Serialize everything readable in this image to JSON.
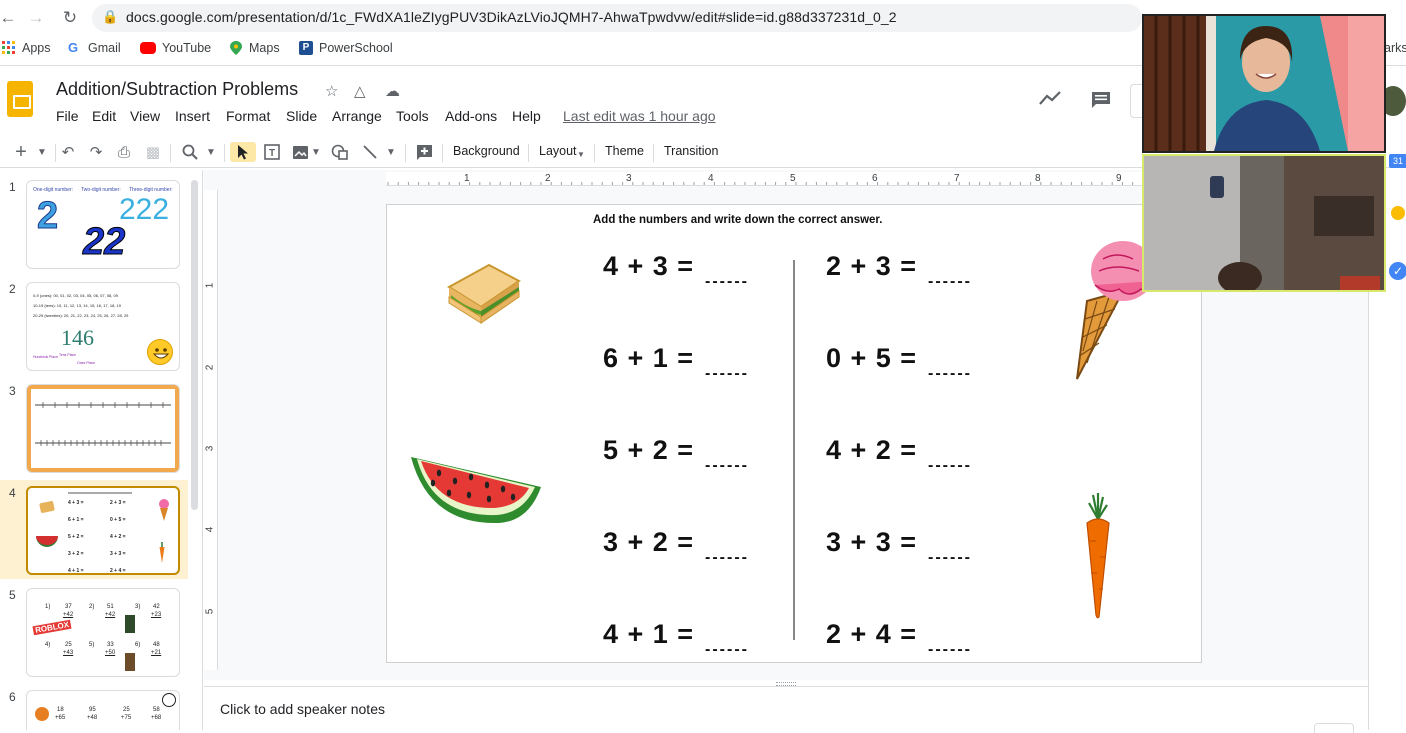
{
  "browser": {
    "url": "docs.google.com/presentation/d/1c_FWdXA1leZIygPUV3DikAzLVioJQMH7-AhwaTpwdvw/edit#slide=id.g88d337231d_0_2",
    "bookmarks": [
      "Apps",
      "Gmail",
      "YouTube",
      "Maps",
      "PowerSchool"
    ],
    "edge_text": "arks"
  },
  "app": {
    "title": "Addition/Subtraction Problems",
    "menu": [
      "File",
      "Edit",
      "View",
      "Insert",
      "Format",
      "Slide",
      "Arrange",
      "Tools",
      "Add-ons",
      "Help"
    ],
    "last_edit": "Last edit was 1 hour ago"
  },
  "toolbar": {
    "background": "Background",
    "layout": "Layout",
    "theme": "Theme",
    "transition": "Transition"
  },
  "filmstrip": {
    "slide_numbers": [
      "1",
      "2",
      "3",
      "4",
      "5",
      "6"
    ],
    "selected": "4",
    "slide1": {
      "labels": [
        "One-digit number:",
        "Two-digit number:",
        "Three-digit number:"
      ],
      "nums": [
        "2",
        "22",
        "222"
      ]
    },
    "slide2": {
      "lines": [
        "0-9 (ones): 00, 01, 02, 03, 04, 05, 06, 07, 08, 09",
        "10-19 (tens): 10, 11, 12, 13, 14, 15, 16, 17, 18, 19",
        "20-29 (twenties): 20, 21, 22, 23, 24, 25, 26, 27, 28, 29"
      ],
      "num": "146",
      "tags": [
        "Hundreds Place",
        "Tens Place",
        "Ones Place"
      ]
    },
    "slide5": {
      "logo": "ROBLOX",
      "rows": [
        "1)",
        "37",
        "+42",
        "2)",
        "51",
        "+42",
        "3)",
        "42",
        "+23",
        "4)",
        "25",
        "+43",
        "5)",
        "33",
        "+50",
        "6)",
        "48",
        "+21"
      ]
    },
    "slide6": {
      "rows": [
        "18",
        "+65",
        "95",
        "+48",
        "25",
        "+75",
        "58",
        "+68"
      ]
    }
  },
  "ruler": {
    "h": [
      "1",
      "2",
      "3",
      "4",
      "5",
      "6",
      "7",
      "8",
      "9"
    ],
    "v": [
      "1",
      "2",
      "3",
      "4",
      "5"
    ]
  },
  "slide": {
    "instruction": "Add the numbers and write down the correct answer.",
    "left": [
      "4 + 3 =",
      "6 + 1 =",
      "5 + 2 =",
      "3 + 2 =",
      "4 + 1 ="
    ],
    "right": [
      "2 + 3 =",
      "0 + 5 =",
      "4 + 2 =",
      "3 + 3 =",
      "2 + 4 ="
    ],
    "blank": "------"
  },
  "notes": {
    "placeholder": "Click to add speaker notes"
  },
  "right_rail": {
    "calendar_badge": "31"
  },
  "colors": {
    "slides_yellow": "#f4b400",
    "selected_border": "#c38b00",
    "selected_bg": "#fdf1d2"
  }
}
